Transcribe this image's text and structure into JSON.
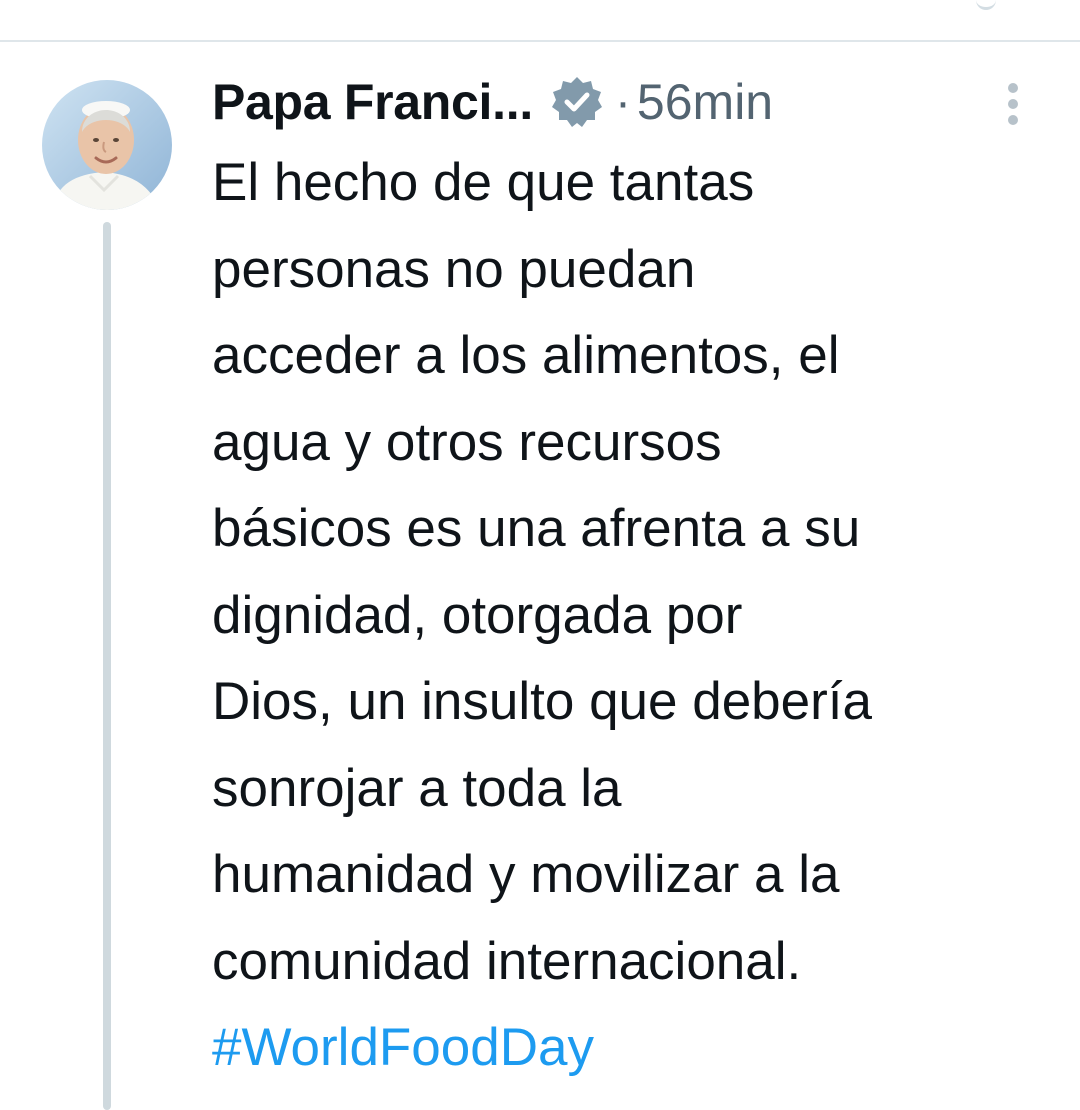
{
  "post": {
    "author_name": "Papa Franci...",
    "separator": "·",
    "timestamp": "56min",
    "text_lines": [
      "El hecho de que tantas",
      "personas no puedan",
      "acceder a los alimentos, el",
      "agua y otros recursos",
      "básicos es una afrenta a su",
      "dignidad, otorgada por",
      "Dios, un insulto que debería",
      "sonrojar a toda la",
      "humanidad y movilizar a la",
      "comunidad internacional."
    ],
    "hashtag": "#WorldFoodDay"
  },
  "icons": {
    "verified": "verified-badge-icon",
    "more": "more-options-icon"
  },
  "colors": {
    "text": "#0f1419",
    "secondary": "#536471",
    "hashtag": "#1d9bf0",
    "badge": "#829aab",
    "thread_line": "#cfd9de",
    "divider": "#dfe6ea"
  }
}
